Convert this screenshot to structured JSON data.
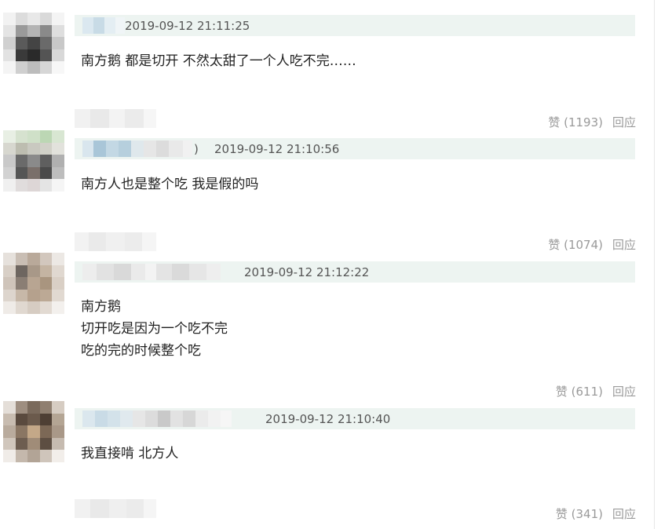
{
  "comments": [
    {
      "timestamp": "2019-09-12 21:11:25",
      "lines": [
        "南方鹅 都是切开 不然太甜了一个人吃不完……"
      ],
      "likes": "赞 (1193)",
      "reply": "回应"
    },
    {
      "timestamp": "2019-09-12 21:10:56",
      "bracket": ")",
      "lines": [
        "南方人也是整个吃 我是假的吗"
      ],
      "likes": "赞 (1074)",
      "reply": "回应"
    },
    {
      "timestamp": "2019-09-12 21:12:22",
      "lines": [
        "南方鹅",
        "切开吃是因为一个吃不完",
        "吃的完的时候整个吃"
      ],
      "likes": "赞 (611)",
      "reply": "回应"
    },
    {
      "timestamp": "2019-09-12 21:10:40",
      "lines": [
        "我直接啃 北方人"
      ],
      "likes": "赞 (341)",
      "reply": "回应"
    }
  ],
  "colors": {
    "header_bg": "#edf4f1",
    "text": "#222222",
    "muted": "#9a9a9a",
    "timestamp": "#555555"
  }
}
